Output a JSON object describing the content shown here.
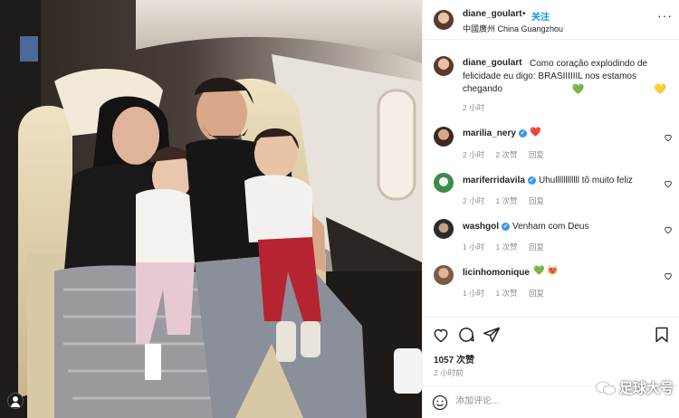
{
  "header": {
    "username": "diane_goulart",
    "separator": "•",
    "follow_label": "关注",
    "location": "中國廣州 China Guangzhou",
    "more_icon": "more-dots-icon"
  },
  "caption": {
    "username": "diane_goulart",
    "text": "Como coração explodindo de felicidade eu digo: BRASIIIIIIL nos estamos chegando",
    "emojis": [
      "💚",
      "💛"
    ],
    "time": "2 小时"
  },
  "comments": [
    {
      "username": "marilia_nery",
      "verified": true,
      "text": "",
      "emoji": "❤️",
      "time": "2 小时",
      "likes": "2 次赞",
      "reply": "回复"
    },
    {
      "username": "mariferridavila",
      "verified": true,
      "text": "Uhullllllllllll tô muito feliz",
      "emoji": "",
      "time": "2 小时",
      "likes": "1 次赞",
      "reply": "回复"
    },
    {
      "username": "washgol",
      "verified": true,
      "text": "Venham com Deus",
      "emoji": "",
      "time": "1 小时",
      "likes": "1 次赞",
      "reply": "回复"
    },
    {
      "username": "licinhomonique",
      "verified": false,
      "text": "",
      "emoji": "💚 😻",
      "time": "1 小时",
      "likes": "1 次赞",
      "reply": "回复"
    }
  ],
  "actions": {
    "icons": [
      "heart-icon",
      "comment-icon",
      "share-icon",
      "bookmark-icon"
    ]
  },
  "likes": "1057 次赞",
  "post_time": "2 小时前",
  "add_comment": {
    "placeholder": "添加评论..."
  },
  "watermark": "足球大号",
  "colors": {
    "follow": "#0095f6",
    "verified": "#3897f0",
    "meta": "#8e8e8e"
  }
}
